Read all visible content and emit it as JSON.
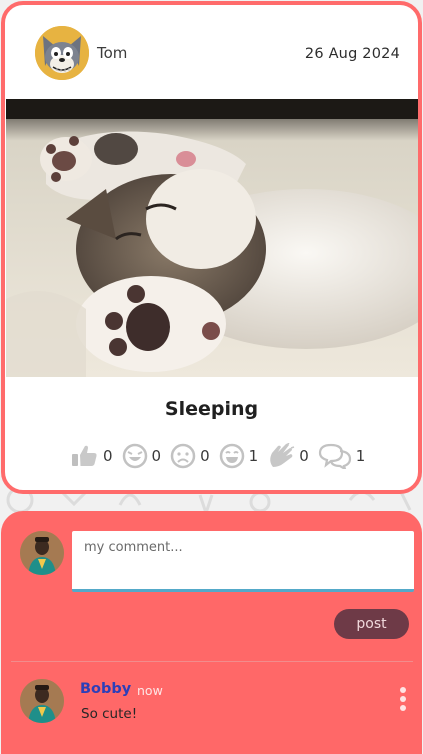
{
  "post": {
    "author": "Tom",
    "date": "26 Aug 2024",
    "title": "Sleeping",
    "image_description": "kitten-sleeping",
    "reactions": [
      {
        "icon": "thumbs-up-icon",
        "count": "0"
      },
      {
        "icon": "laughing-face-icon",
        "count": "0"
      },
      {
        "icon": "sad-face-icon",
        "count": "0"
      },
      {
        "icon": "happy-face-icon",
        "count": "1"
      },
      {
        "icon": "clapping-hands-icon",
        "count": "0"
      },
      {
        "icon": "comments-icon",
        "count": "1"
      }
    ]
  },
  "comment_form": {
    "placeholder": "my comment...",
    "post_label": "post"
  },
  "comments": [
    {
      "author": "Bobby",
      "time": "now",
      "text": "So cute!"
    }
  ],
  "colors": {
    "accent": "#ff6b6b",
    "comment_author": "#2d3fb8",
    "post_button": "#6e3a47",
    "input_underline": "#53a9c9"
  }
}
